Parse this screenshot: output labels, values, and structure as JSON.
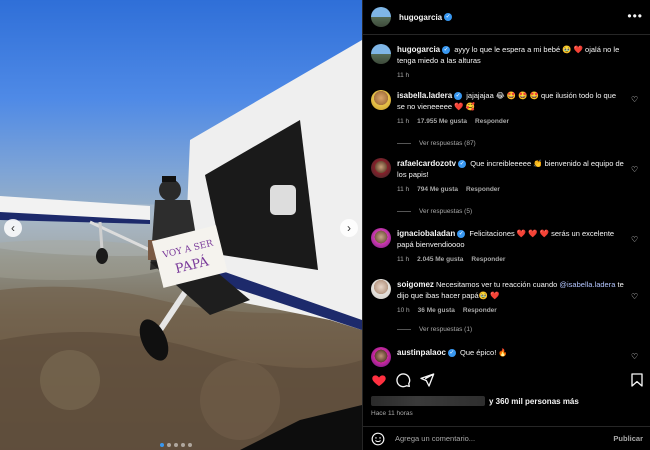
{
  "post": {
    "author": "hugogarcia",
    "verified": true,
    "caption_user": "hugogarcia",
    "caption_text": "ayyy lo que le espera a mi bebé 🥹 ❤️ ojalá no le tenga miedo a las alturas",
    "caption_time": "11 h",
    "sign_text": "VOY A SER PAPÁ"
  },
  "comments": [
    {
      "user": "isabella.ladera",
      "text": "jajajajaa 😂 🤩 🤩 🤩 que ilusión todo lo que se no vieneeeee ❤️ 🥰",
      "time": "11 h",
      "likes": "17.955 Me gusta",
      "reply": "Responder",
      "replies": "Ver respuestas (87)"
    },
    {
      "user": "rafaelcardozotv",
      "text": "Que increibleeeee 👏 bienvenido al equipo de los papis!",
      "time": "11 h",
      "likes": "794 Me gusta",
      "reply": "Responder",
      "replies": "Ver respuestas (5)"
    },
    {
      "user": "ignaciobaladan",
      "text": "Felicitaciones ❤️ ❤️ ❤️ serás un excelente papá bienvendioooo",
      "time": "11 h",
      "likes": "2.045 Me gusta",
      "reply": "Responder",
      "replies": ""
    },
    {
      "user": "soigomez",
      "text_before": "Necesitamos ver tu reacción cuando",
      "mention": "@isabella.ladera",
      "text_after": "te dijo que ibas hacer papá🥹 ❤️",
      "time": "10 h",
      "likes": "36 Me gusta",
      "reply": "Responder",
      "replies": "Ver respuestas (1)"
    },
    {
      "user": "austinpalaoc",
      "text": "Que épico! 🔥",
      "time": "",
      "likes": "",
      "reply": "",
      "replies": ""
    }
  ],
  "likes_summary": "y 360 mil personas más",
  "posted_ago": "Hace 11 horas",
  "composer": {
    "placeholder": "Agrega un comentario...",
    "publish": "Publicar"
  },
  "icons": [
    "more-icon",
    "heart-icon",
    "comment-icon",
    "share-icon",
    "bookmark-icon",
    "emoji-icon",
    "verified-icon",
    "chevron-left-icon",
    "chevron-right-icon"
  ],
  "colors": {
    "background": "#000000",
    "secondary_text": "#a8a8a8",
    "verified": "#3897f0",
    "liked": "#ff3040",
    "mention": "#b4c6ff"
  }
}
